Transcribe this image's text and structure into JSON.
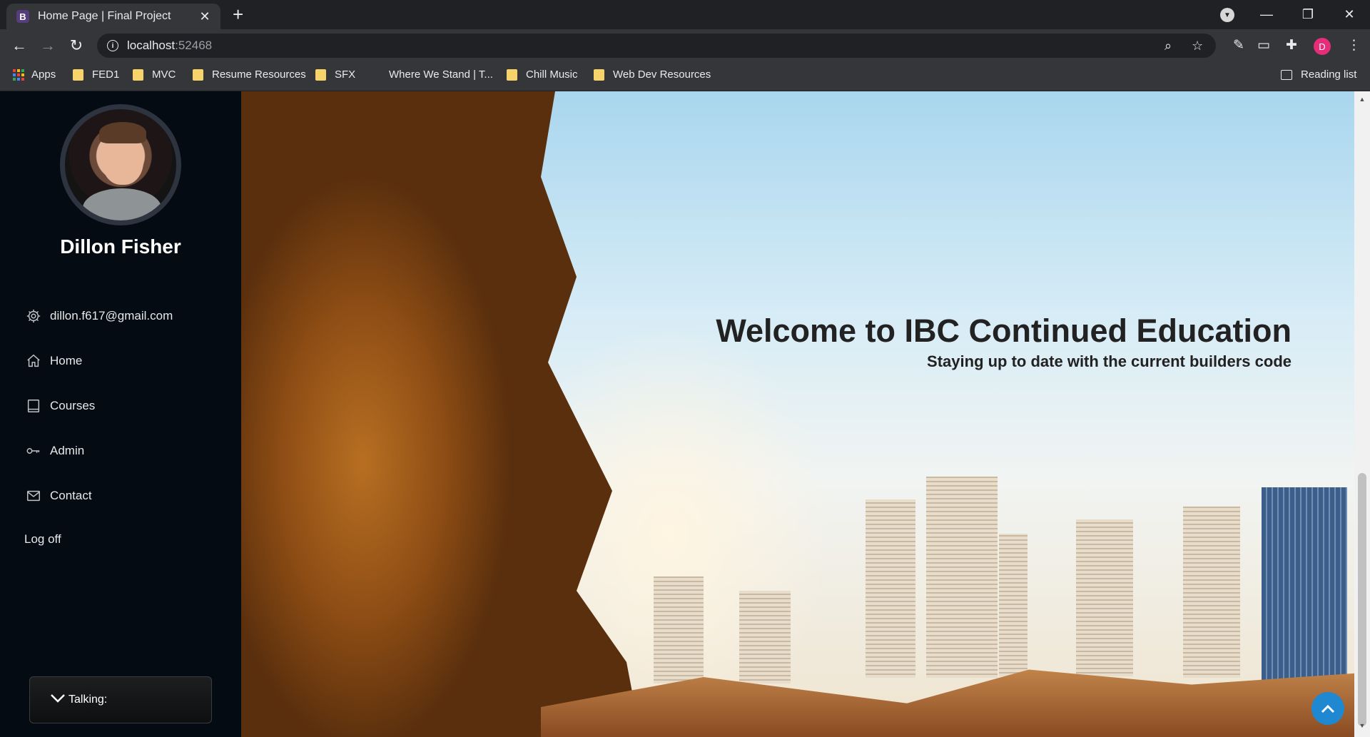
{
  "browser": {
    "tab_title": "Home Page | Final Project",
    "tab_favicon": "B",
    "url_host": "localhost",
    "url_port": ":52468",
    "profile_initial": "D",
    "bookmarks": [
      {
        "label": "Apps",
        "icon": "apps-grid-icon"
      },
      {
        "label": "FED1",
        "icon": "folder-icon"
      },
      {
        "label": "MVC",
        "icon": "folder-icon"
      },
      {
        "label": "Resume Resources",
        "icon": "folder-icon"
      },
      {
        "label": "SFX",
        "icon": "folder-icon"
      },
      {
        "label": "Where We Stand | T...",
        "icon": "none"
      },
      {
        "label": "Chill Music",
        "icon": "folder-icon"
      },
      {
        "label": "Web Dev Resources",
        "icon": "folder-icon"
      }
    ],
    "reading_list": "Reading list"
  },
  "sidebar": {
    "user_name": "Dillon Fisher",
    "items": [
      {
        "label": "dillon.f617@gmail.com",
        "icon": "gear-icon"
      },
      {
        "label": "Home",
        "icon": "home-icon"
      },
      {
        "label": "Courses",
        "icon": "book-icon"
      },
      {
        "label": "Admin",
        "icon": "key-icon"
      },
      {
        "label": "Contact",
        "icon": "mail-icon"
      }
    ],
    "log_off": "Log off",
    "talking": "Talking:"
  },
  "hero": {
    "title": "Welcome to IBC Continued Education",
    "subtitle": "Staying up to date with the current builders code"
  },
  "colors": {
    "sidebar_bg": "#050b12",
    "scroll_top_button": "#1f88d1",
    "browser_frame": "#202124",
    "toolbar": "#35363a"
  }
}
